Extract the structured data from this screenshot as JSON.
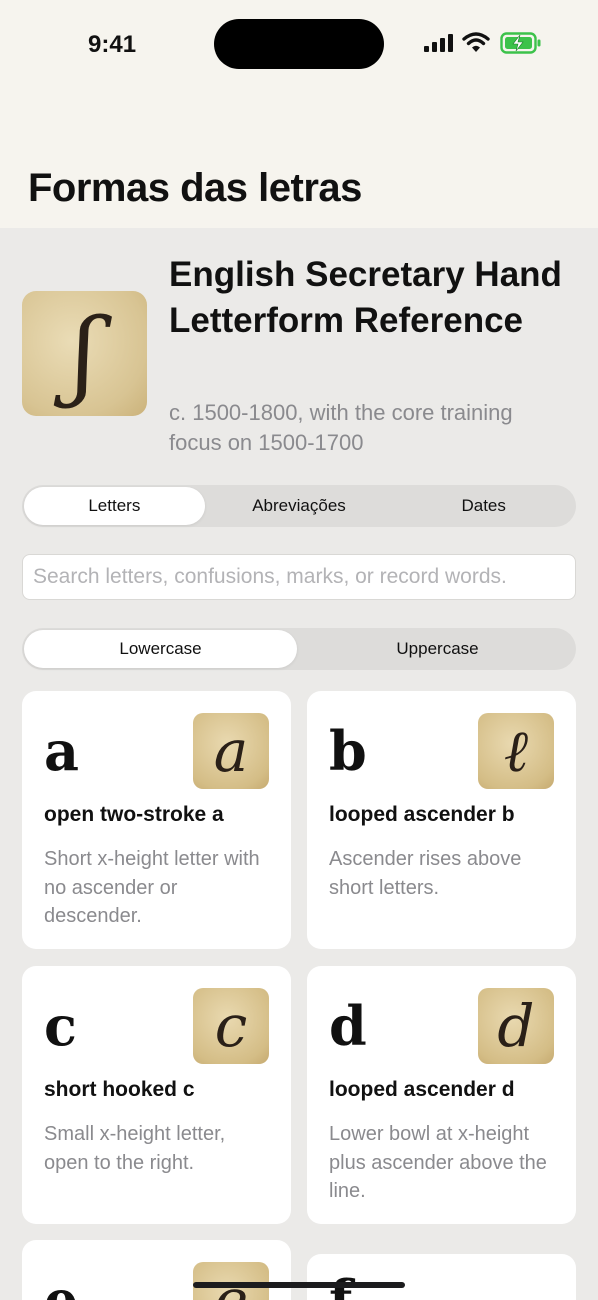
{
  "status_bar": {
    "time": "9:41"
  },
  "page": {
    "title": "Formas das letras"
  },
  "hero": {
    "thumb_glyph": "ʃ",
    "title": "English Secretary Hand Letterform Reference",
    "subtitle": "c. 1500-1800, with the core training focus on 1500-1700"
  },
  "tabs": [
    {
      "label": "Letters",
      "active": true
    },
    {
      "label": "Abreviações",
      "active": false
    },
    {
      "label": "Dates",
      "active": false
    }
  ],
  "search": {
    "placeholder": "Search letters, confusions, marks, or record words.",
    "value": ""
  },
  "case_toggle": [
    {
      "label": "Lowercase",
      "active": true
    },
    {
      "label": "Uppercase",
      "active": false
    }
  ],
  "cards": [
    {
      "letter": "a",
      "thumb_glyph": "a",
      "title": "open two-stroke a",
      "description": "Short x-height letter with no ascender or descender."
    },
    {
      "letter": "b",
      "thumb_glyph": "ℓ",
      "title": "looped ascender b",
      "description": "Ascender rises above short letters."
    },
    {
      "letter": "c",
      "thumb_glyph": "c",
      "title": "short hooked c",
      "description": "Small x-height letter, open to the right."
    },
    {
      "letter": "d",
      "thumb_glyph": "d",
      "title": "looped ascender d",
      "description": "Lower bowl at x-height plus ascender above the line."
    },
    {
      "letter": "e",
      "thumb_glyph": "e",
      "title": "",
      "description": ""
    },
    {
      "letter": "f",
      "thumb_glyph": "",
      "title": "",
      "description": ""
    }
  ],
  "colors": {
    "background": "#ebeae8",
    "header_background": "#f6f4ee",
    "secondary_text": "#8a8a8e",
    "battery_green": "#3cc24a"
  }
}
